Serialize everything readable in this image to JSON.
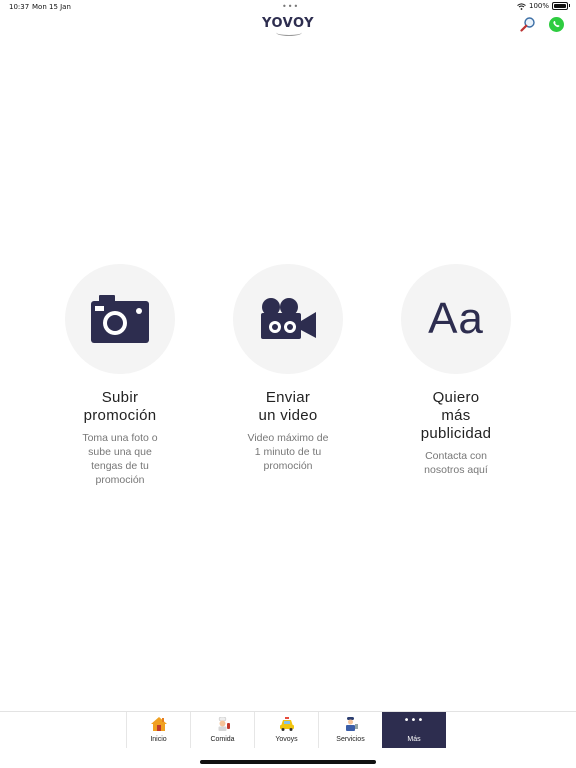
{
  "status_bar": {
    "time": "10:37",
    "date": "Mon 15 Jan",
    "battery": "100%"
  },
  "header": {
    "logo": "YOVOY",
    "icons": [
      "search-icon",
      "whatsapp-icon"
    ]
  },
  "options": [
    {
      "icon": "camera-icon",
      "title": "Subir\npromoción",
      "description": "Toma una foto o\nsube una que\ntengas de tu\npromoción"
    },
    {
      "icon": "video-camera-icon",
      "title": "Enviar\nun video",
      "description": "Video máximo de\n1 minuto de tu\npromoción"
    },
    {
      "icon": "text-icon",
      "icon_text": "Aa",
      "title": "Quiero\nmás\npublicidad",
      "description": "Contacta con\nnosotros aquí"
    }
  ],
  "tabs": [
    {
      "label": "Inicio",
      "icon": "home-icon"
    },
    {
      "label": "Comida",
      "icon": "chef-icon"
    },
    {
      "label": "Yovoys",
      "icon": "taxi-icon"
    },
    {
      "label": "Servicios",
      "icon": "worker-icon"
    },
    {
      "label": "Más",
      "icon": "more-icon",
      "icon_text": "•••",
      "active": true
    }
  ],
  "colors": {
    "accent": "#2d2d4f",
    "circle_bg": "#f4f4f4",
    "whatsapp": "#2ecc40"
  }
}
